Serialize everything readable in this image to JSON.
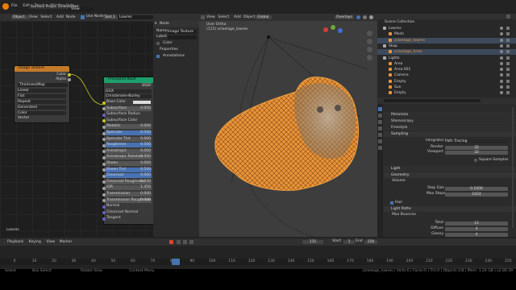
{
  "topbar": {
    "menus": [
      "File",
      "Edit",
      "Render",
      "Window",
      "Help"
    ],
    "workspace": "Surface Project",
    "scene_tag": "Orientation",
    "view_layer": "View"
  },
  "node_editor": {
    "header": {
      "editor_type": "Object",
      "menus": [
        "View",
        "Select",
        "Add",
        "Node"
      ],
      "use_nodes": "Use Nodes",
      "slot": "Slot 1",
      "material": "Lowres"
    },
    "texture_node": {
      "title": "Image Texture",
      "out_color": "Color",
      "out_alpha": "Alpha",
      "image": "ThicknessMap",
      "interpolation": "Linear",
      "projection": "Flat",
      "extension": "Repeat",
      "source": "Generated",
      "color_space": "Color",
      "vector": "Vector"
    },
    "bsdf_node": {
      "title": "Principled BSDF",
      "output": "BSDF",
      "distribution": "GGX",
      "subsurface_method": "Christensen-Burley",
      "inputs": [
        {
          "label": "Base Color",
          "value": ""
        },
        {
          "label": "Subsurface",
          "value": "0.000"
        },
        {
          "label": "Subsurface Radius",
          "value": ""
        },
        {
          "label": "Subsurface Color",
          "value": ""
        },
        {
          "label": "Metallic",
          "value": "0.000"
        },
        {
          "label": "Specular",
          "value": "0.500"
        },
        {
          "label": "Specular Tint",
          "value": "0.000"
        },
        {
          "label": "Roughness",
          "value": "0.500"
        },
        {
          "label": "Anisotropic",
          "value": "0.000"
        },
        {
          "label": "Anisotropic Rotation",
          "value": "0.000"
        },
        {
          "label": "Sheen",
          "value": "0.000"
        },
        {
          "label": "Sheen Tint",
          "value": "0.500"
        },
        {
          "label": "Clearcoat",
          "value": "0.000"
        },
        {
          "label": "Clearcoat Roughness",
          "value": "0.030"
        },
        {
          "label": "IOR",
          "value": "1.450"
        },
        {
          "label": "Transmission",
          "value": "0.000"
        },
        {
          "label": "Transmission Roughness",
          "value": "0.000"
        },
        {
          "label": "Normal",
          "value": ""
        },
        {
          "label": "Clearcoat Normal",
          "value": ""
        },
        {
          "label": "Tangent",
          "value": ""
        }
      ]
    },
    "footer_label": "Lowres"
  },
  "node_sidebar": {
    "section": "Node",
    "name_label": "Name:",
    "name_value": "Image Texture",
    "label_label": "Label:",
    "color_label": "Color",
    "properties_label": "Properties",
    "annotations_label": "Annotations"
  },
  "viewport": {
    "header": {
      "menus": [
        "View",
        "Select",
        "Add",
        "Object"
      ],
      "orientation": "Global",
      "overlays": "Overlays"
    },
    "info_line1": "User Ortho",
    "info_line2": "(115) scleelage_lowres"
  },
  "outliner": {
    "title": "Scene Collection",
    "items": [
      {
        "label": "Lowres",
        "indent": 1
      },
      {
        "label": "Mesh",
        "indent": 2
      },
      {
        "label": "scleelage_lowres",
        "indent": 2
      },
      {
        "label": "Skap",
        "indent": 1
      },
      {
        "label": "scleelage_hires",
        "indent": 2
      },
      {
        "label": "Lights",
        "indent": 1
      },
      {
        "label": "Area",
        "indent": 2
      },
      {
        "label": "Area.001",
        "indent": 2
      },
      {
        "label": "Camera",
        "indent": 2
      },
      {
        "label": "Empty",
        "indent": 2
      },
      {
        "label": "Sun",
        "indent": 2
      },
      {
        "label": "Empty",
        "indent": 2
      }
    ]
  },
  "properties": {
    "sections_top": [
      "Metadata",
      "Stereoscopy",
      "Freestyle"
    ],
    "sampling": {
      "title": "Sampling",
      "integrator_label": "Integrator",
      "integrator_value": "Path Tracing",
      "render_label": "Render",
      "render_value": "32",
      "viewport_label": "Viewport",
      "viewport_value": "32",
      "square_label": "Square Samples"
    },
    "light_label": "Light",
    "geometry_label": "Geometry",
    "volume": {
      "title": "Volume",
      "step_label": "Step Size",
      "step_value": "0.1000",
      "max_steps_label": "Max Steps",
      "max_steps_value": "1024"
    },
    "hair_label": "Hair",
    "light_paths": {
      "title": "Light Paths",
      "max_bounces": "Max Bounces",
      "rows": [
        {
          "label": "Total",
          "value": "12"
        },
        {
          "label": "Diffuse",
          "value": "4"
        },
        {
          "label": "Glossy",
          "value": "4"
        },
        {
          "label": "Transparency",
          "value": "8"
        },
        {
          "label": "Transmission",
          "value": "12"
        },
        {
          "label": "Volume",
          "value": "0"
        }
      ]
    },
    "caustics_label": "Caustics"
  },
  "timeline": {
    "menus": [
      "Playback",
      "Keying",
      "View",
      "Marker"
    ],
    "current_frame": "115",
    "start_label": "Start",
    "start_value": "1",
    "end_label": "End",
    "end_value": "250",
    "ticks": [
      "0",
      "10",
      "20",
      "30",
      "40",
      "50",
      "60",
      "70",
      "80",
      "90",
      "100",
      "110",
      "120",
      "130",
      "140",
      "150",
      "160",
      "170",
      "180",
      "190",
      "200",
      "210",
      "220",
      "230",
      "240",
      "250"
    ]
  },
  "statusbar": {
    "left": "Select",
    "mid1": "Box Select",
    "mid2": "Rotate View",
    "mid3": "Context Menu",
    "right": "scleelage_lowres | Verts:6 | Faces:0 | Tris:0 | Objects:1/8 | Mem: 1.24 GB | v2.80.39"
  },
  "colors": {
    "accent": "#d67a00",
    "selected": "#4772b3",
    "mesh": "#e8943a",
    "viewport_bg": "#3d3d3d"
  }
}
